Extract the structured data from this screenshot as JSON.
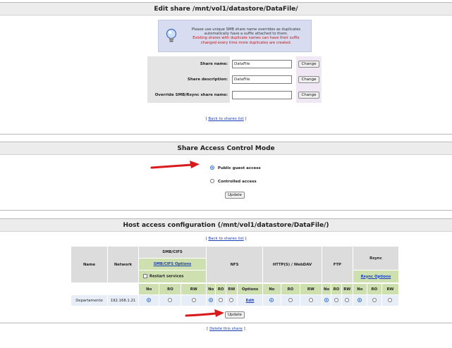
{
  "edit_share": {
    "title": "Edit share /mnt/vol1/datastore/DataFile/",
    "notice_line1": "Please use unique SMB share name overrides as duplicates",
    "notice_line2": "automatically have a suffix attached to them.",
    "notice_line3": "Existing shares with duplicate names can have their suffix",
    "notice_line4": "changed every time more duplicates are created.",
    "fields": [
      {
        "label": "Share name:",
        "value": "DataFile",
        "button": "Change"
      },
      {
        "label": "Share description:",
        "value": "DataFile",
        "button": "Change"
      },
      {
        "label": "Override SMB/Rsync share name:",
        "value": "",
        "button": "Change"
      }
    ],
    "back_link_open": "[",
    "back_link": "Back to shares list",
    "back_link_close": "]"
  },
  "access_mode": {
    "title": "Share Access Control Mode",
    "options": [
      {
        "label": "Public guest access",
        "selected": true
      },
      {
        "label": "Controlled access",
        "selected": false
      }
    ],
    "update_label": "Update"
  },
  "host_access": {
    "title": "Host access configuration (/mnt/vol1/datastore/DataFile/)",
    "back_link_open": "[",
    "back_link": "Back to shares list",
    "back_link_close": "]",
    "headers": {
      "name": "Name",
      "network": "Network",
      "smb": "SMB/CIFS",
      "smb_options": "SMB/CIFS Options",
      "restart_services": "Restart services",
      "nfs": "NFS",
      "http": "HTTP(S) / WebDAV",
      "ftp": "FTP",
      "rsync": "Rsync",
      "rsync_options": "Rsync Options",
      "no": "No",
      "ro": "RO",
      "rw": "RW",
      "options": "Options"
    },
    "row": {
      "name": "Departamento",
      "network": "192.168.1.21",
      "edit": "Edit",
      "smb": "no",
      "nfs": "no",
      "http": "no",
      "ftp": "no",
      "rsync": "no"
    },
    "update_label": "Update",
    "delete_open": "[",
    "delete_link": "Delete this share",
    "delete_close": "]"
  },
  "colors": {
    "accent": "#2a6ad4",
    "arrow": "#d81a1a",
    "header_bg": "#ececec",
    "notice_bg": "#d8dcf0",
    "green_header": "#cfe0b0"
  }
}
